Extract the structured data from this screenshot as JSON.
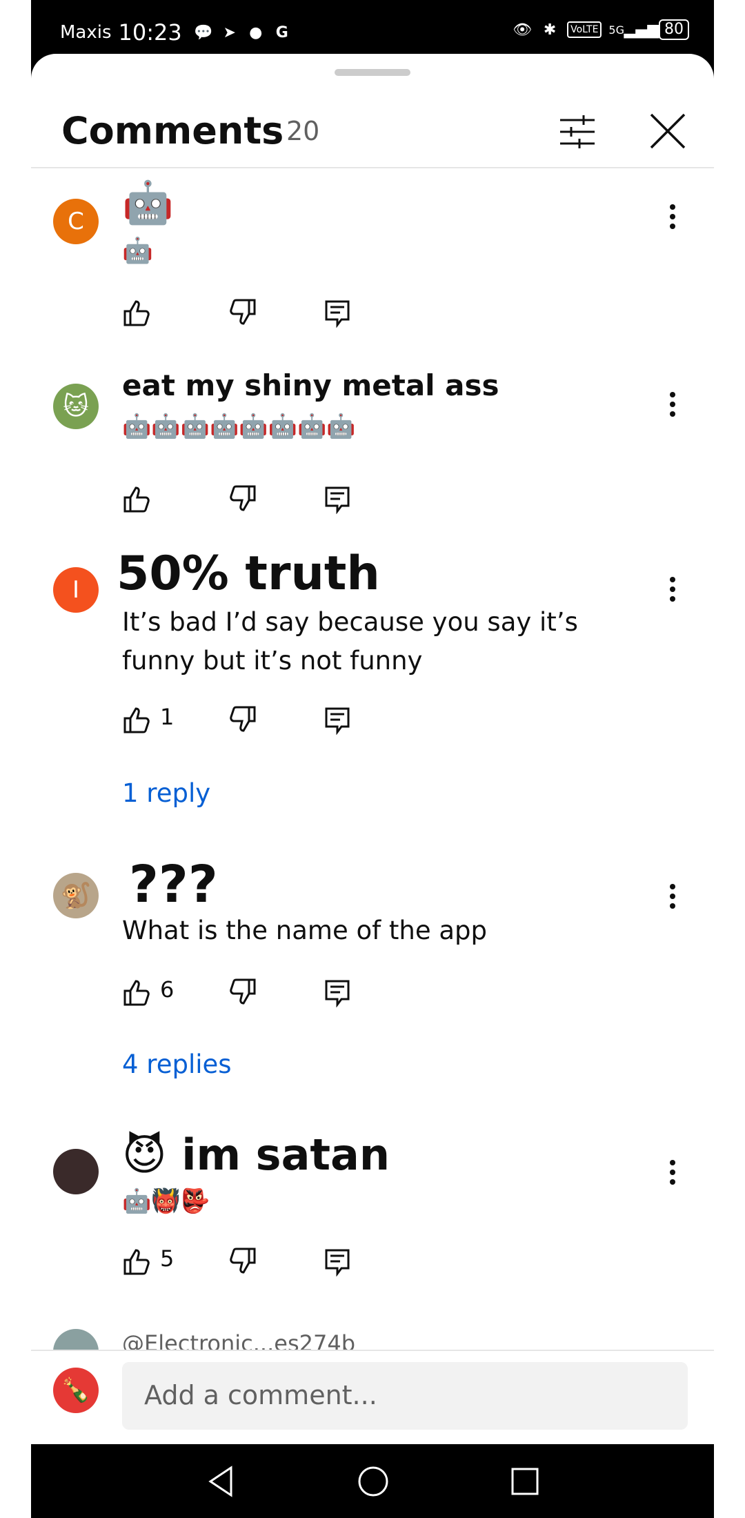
{
  "status_bar": {
    "carrier": "Maxis",
    "time": "10:23",
    "network": "5G",
    "volte": "VoLTE",
    "battery": "80"
  },
  "header": {
    "title": "Comments",
    "count": "20"
  },
  "comments": [
    {
      "avatar_letter": "C",
      "avatar_color": "#e8710a",
      "author": "🤖",
      "text": "🤖",
      "likes": ""
    },
    {
      "avatar_letter": "",
      "avatar_color": "#7aa152",
      "author": "eat my shiny metal ass",
      "text": "🤖🤖🤖🤖🤖🤖🤖🤖",
      "likes": ""
    },
    {
      "avatar_letter": "I",
      "avatar_color": "#f4511e",
      "author": "50% truth",
      "text": "It’s bad I’d say because you say it’s funny but it’s not funny",
      "likes": "1",
      "replies": "1 reply"
    },
    {
      "avatar_letter": "",
      "avatar_color": "#b8a58a",
      "author": "???",
      "text": "What is the name of the app",
      "likes": "6",
      "replies": "4 replies"
    },
    {
      "avatar_letter": "",
      "avatar_color": "#3a2a2a",
      "author": "😈 im satan",
      "text": "🤖👹👺",
      "likes": "5"
    }
  ],
  "peek_author": "@Electronic...es274b",
  "composer": {
    "placeholder": "Add a comment..."
  }
}
